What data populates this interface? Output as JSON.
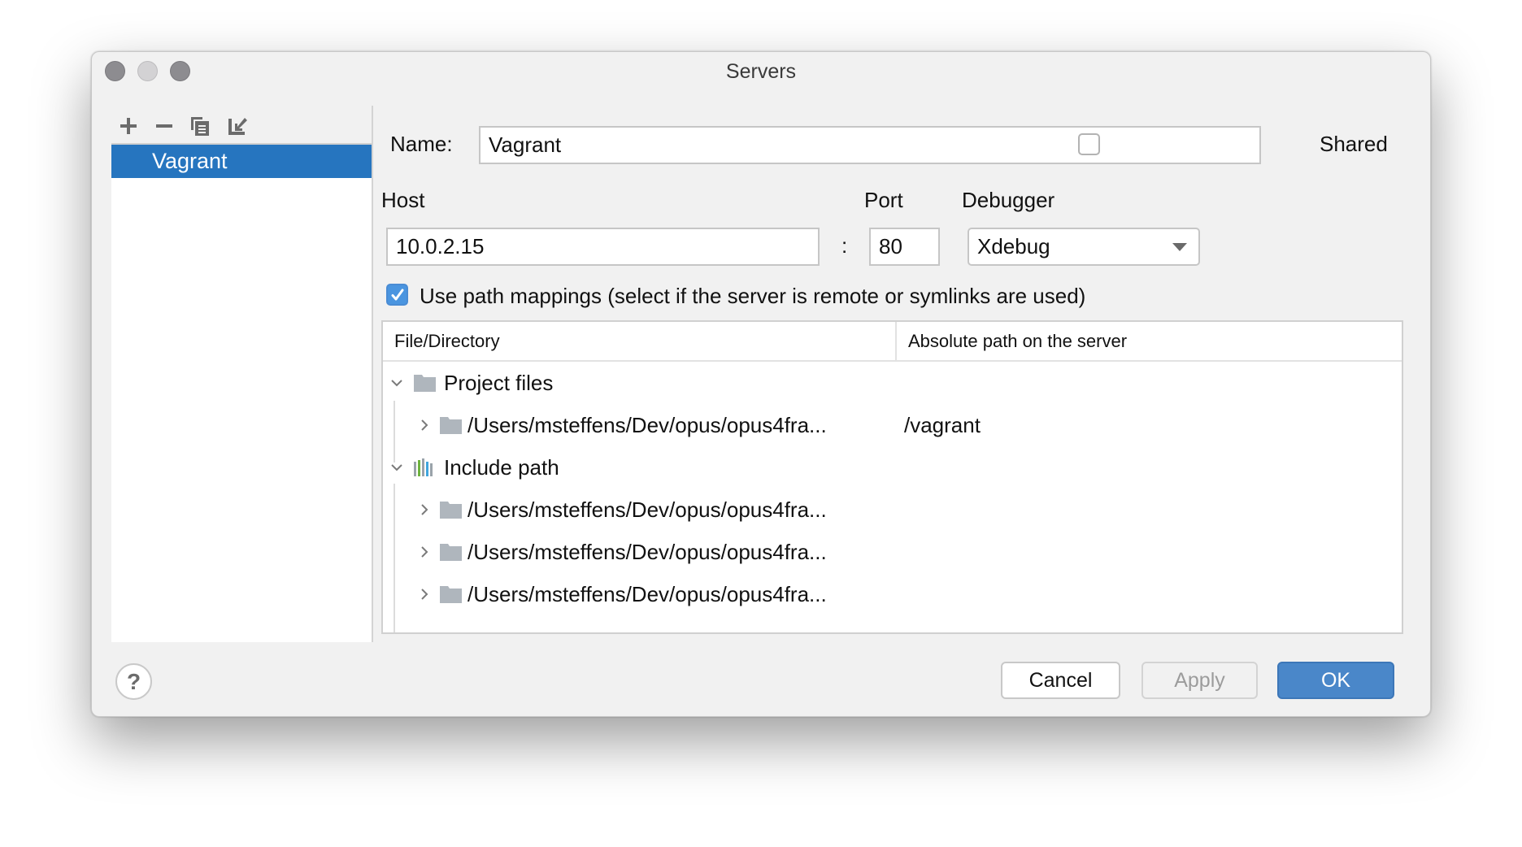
{
  "window": {
    "title": "Servers"
  },
  "sidebar": {
    "toolbar": [
      {
        "name": "add-icon",
        "label": "Add"
      },
      {
        "name": "remove-icon",
        "label": "Remove"
      },
      {
        "name": "copy-icon",
        "label": "Copy"
      },
      {
        "name": "import-icon",
        "label": "Import"
      }
    ],
    "servers": [
      {
        "label": "Vagrant",
        "selected": true
      }
    ]
  },
  "form": {
    "name_label": "Name:",
    "name_value": "Vagrant",
    "shared_label": "Shared",
    "shared_checked": false,
    "host_label": "Host",
    "host_value": "10.0.2.15",
    "colon": ":",
    "port_label": "Port",
    "port_value": "80",
    "debugger_label": "Debugger",
    "debugger_value": "Xdebug",
    "path_mappings_label": "Use path mappings (select if the server is remote or symlinks are used)",
    "path_mappings_checked": true
  },
  "mappings_table": {
    "columns": [
      "File/Directory",
      "Absolute path on the server"
    ],
    "rows": [
      {
        "level": 0,
        "expanded": true,
        "icon": "folder-icon",
        "file": "Project files",
        "server_path": ""
      },
      {
        "level": 1,
        "expanded": false,
        "icon": "folder-icon",
        "file": "/Users/msteffens/Dev/opus/opus4fra...",
        "server_path": "/vagrant"
      },
      {
        "level": 0,
        "expanded": true,
        "icon": "library-icon",
        "file": "Include path",
        "server_path": ""
      },
      {
        "level": 1,
        "expanded": false,
        "icon": "folder-icon",
        "file": "/Users/msteffens/Dev/opus/opus4fra...",
        "server_path": ""
      },
      {
        "level": 1,
        "expanded": false,
        "icon": "folder-icon",
        "file": "/Users/msteffens/Dev/opus/opus4fra...",
        "server_path": ""
      },
      {
        "level": 1,
        "expanded": false,
        "icon": "folder-icon",
        "file": "/Users/msteffens/Dev/opus/opus4fra...",
        "server_path": ""
      }
    ]
  },
  "footer": {
    "help_label": "?",
    "cancel_label": "Cancel",
    "apply_label": "Apply",
    "ok_label": "OK"
  },
  "colors": {
    "accent": "#2675bf",
    "ok_button": "#4a87c9",
    "checkbox_checked": "#4a95e0",
    "folder_icon": "#afb6bd",
    "dialog_bg": "#f1f1f1"
  }
}
